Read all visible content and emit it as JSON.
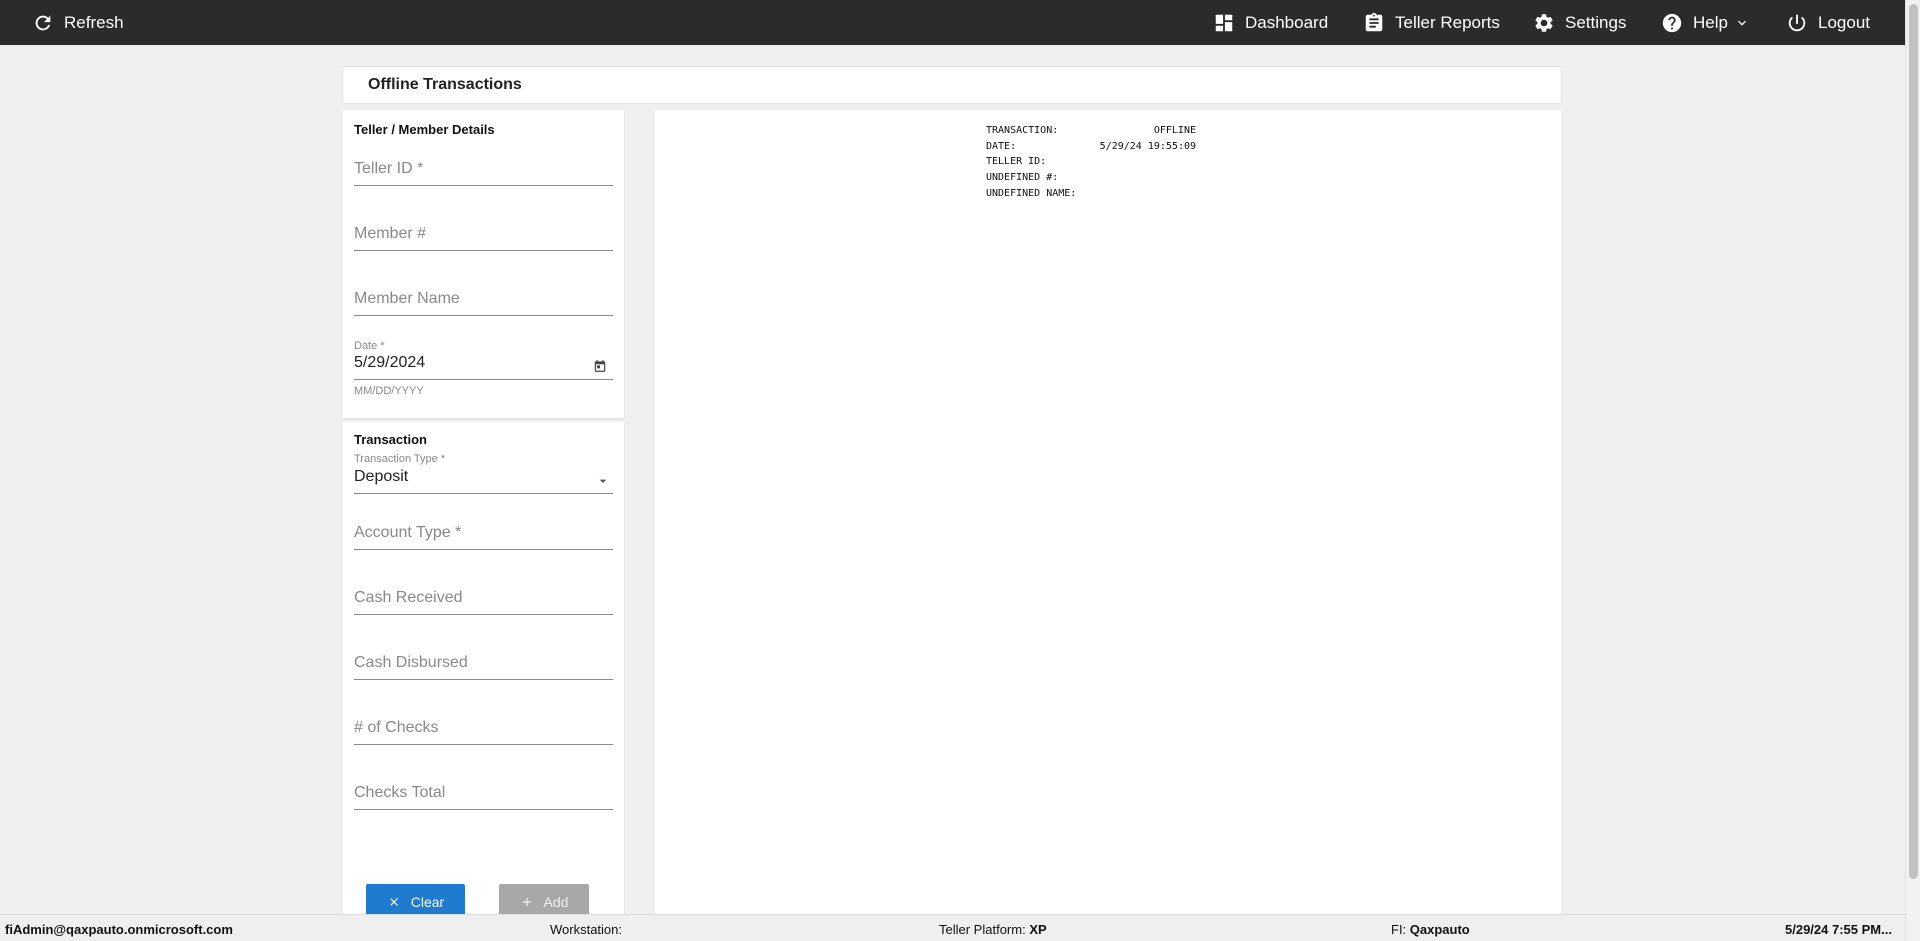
{
  "topbar": {
    "refresh": "Refresh",
    "dashboard": "Dashboard",
    "teller_reports": "Teller Reports",
    "settings": "Settings",
    "help": "Help",
    "logout": "Logout"
  },
  "page": {
    "title": "Offline Transactions"
  },
  "details": {
    "title": "Teller / Member Details",
    "teller_id_placeholder": "Teller ID *",
    "member_num_placeholder": "Member #",
    "member_name_placeholder": "Member Name",
    "date_label": "Date *",
    "date_value": "5/29/2024",
    "date_helper": "MM/DD/YYYY"
  },
  "transaction": {
    "title": "Transaction",
    "type_label": "Transaction Type *",
    "type_value": "Deposit",
    "account_type_placeholder": "Account Type *",
    "cash_received_placeholder": "Cash Received",
    "cash_disbursed_placeholder": "Cash Disbursed",
    "num_checks_placeholder": "# of Checks",
    "checks_total_placeholder": "Checks Total"
  },
  "buttons": {
    "clear": "Clear",
    "add": "Add"
  },
  "receipt": [
    {
      "label": "TRANSACTION:",
      "value": "OFFLINE"
    },
    {
      "label": "DATE:",
      "value": "5/29/24 19:55:09"
    },
    {
      "label": "TELLER ID:",
      "value": ""
    },
    {
      "label": "UNDEFINED #:",
      "value": ""
    },
    {
      "label": "UNDEFINED NAME:",
      "value": ""
    }
  ],
  "status": {
    "user": "fiAdmin@qaxpauto.onmicrosoft.com",
    "workstation_label": "Workstation:",
    "platform_label": "Teller Platform:",
    "platform_value": "XP",
    "fi_label": "FI:",
    "fi_value": "Qaxpauto",
    "datetime": "5/29/24 7:55 PM..."
  },
  "colors": {
    "topbar": "#2b2b2b",
    "primary_button": "#1e7bd0",
    "disabled_button": "#a8a8a8"
  }
}
